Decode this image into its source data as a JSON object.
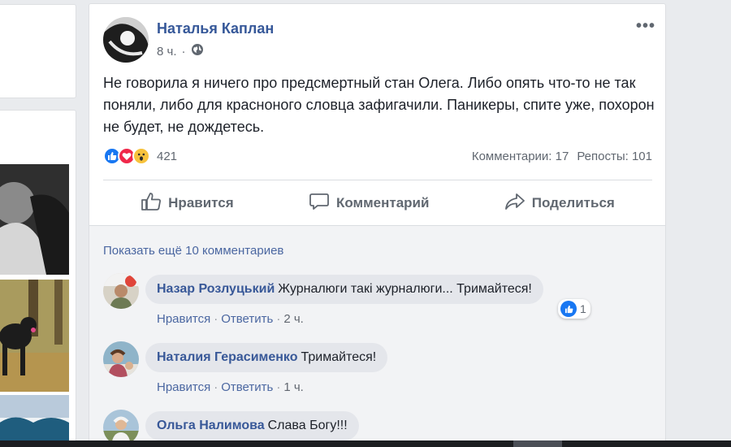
{
  "post": {
    "author": "Наталья Каплан",
    "time": "8 ч.",
    "privacy_icon": "globe-icon",
    "text": "Не говорила я ничего про предсмертный стан Олега. Либо опять что-то не так поняли, либо для красноного словца зафигачили. Паникеры, спите уже, похорон не будет, не дождетесь.",
    "reactions": {
      "types": [
        "like",
        "love",
        "wow"
      ],
      "count": "421"
    },
    "comments_stat": "Комментарии: 17",
    "shares_stat": "Репосты: 101",
    "actions": {
      "like": "Нравится",
      "comment": "Комментарий",
      "share": "Поделиться"
    }
  },
  "comments": {
    "show_more": "Показать ещё 10 комментариев",
    "items": [
      {
        "name": "Назар Розлуцький",
        "text": "Журналюги такі журналюги... Тримайтеся!",
        "like": "Нравится",
        "reply": "Ответить",
        "time": "2 ч.",
        "likes": "1"
      },
      {
        "name": "Наталия Герасименко",
        "text": "Тримайтеся!",
        "like": "Нравится",
        "reply": "Ответить",
        "time": "1 ч."
      },
      {
        "name": "Ольга Налимова",
        "text": "Слава Богу!!!"
      }
    ]
  },
  "colors": {
    "link": "#365899",
    "like_blue": "#1877f2",
    "love_red": "#f0284a",
    "wow_yellow": "#f7c23c"
  }
}
